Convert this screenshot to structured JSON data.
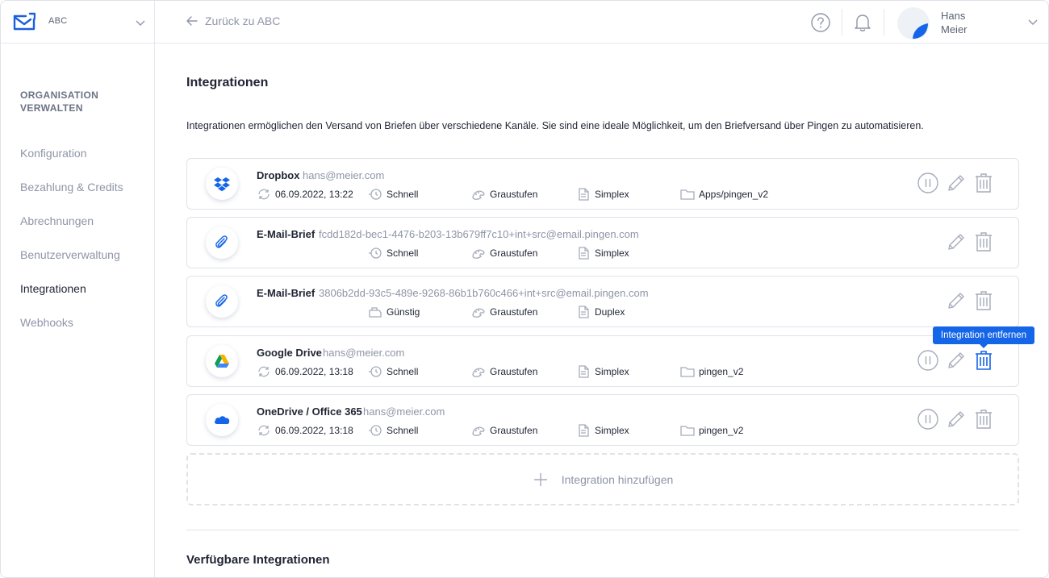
{
  "org": {
    "name": "ABC"
  },
  "header": {
    "back_label": "Zurück zu ABC",
    "user_first": "Hans",
    "user_last": "Meier"
  },
  "sidebar": {
    "heading": "ORGANISATION VERWALTEN",
    "items": [
      {
        "label": "Konfiguration"
      },
      {
        "label": "Bezahlung & Credits"
      },
      {
        "label": "Abrechnungen"
      },
      {
        "label": "Benutzerverwaltung"
      },
      {
        "label": "Integrationen",
        "active": true
      },
      {
        "label": "Webhooks"
      }
    ]
  },
  "main": {
    "title": "Integrationen",
    "intro": "Integrationen ermöglichen den Versand von Briefen über verschiedene Kanäle. Sie sind eine ideale Möglichkeit, um den Briefversand über Pingen zu automatisieren.",
    "integrations": [
      {
        "name": "Dropbox",
        "account": "hans@meier.com",
        "synced": "06.09.2022, 13:22",
        "speed": "Schnell",
        "color": "Graustufen",
        "print": "Simplex",
        "folder": "Apps/pingen_v2",
        "icon": "dropbox-icon"
      },
      {
        "name": "E-Mail-Brief",
        "account": "fcdd182d-bec1-4476-b203-13b679ff7c10+int+src@email.pingen.com",
        "speed": "Schnell",
        "color": "Graustufen",
        "print": "Simplex",
        "icon": "paperclip-icon"
      },
      {
        "name": "E-Mail-Brief",
        "account": "3806b2dd-93c5-489e-9268-86b1b760c466+int+src@email.pingen.com",
        "speed": "Günstig",
        "color": "Graustufen",
        "print": "Duplex",
        "icon": "paperclip-icon"
      },
      {
        "name": "Google Drive",
        "account": "hans@meier.com",
        "synced": "06.09.2022, 13:18",
        "speed": "Schnell",
        "color": "Graustufen",
        "print": "Simplex",
        "folder": "pingen_v2",
        "icon": "google-drive-icon"
      },
      {
        "name": "OneDrive / Office 365",
        "account": "hans@meier.com",
        "synced": "06.09.2022, 13:18",
        "speed": "Schnell",
        "color": "Graustufen",
        "print": "Simplex",
        "folder": "pingen_v2",
        "icon": "onedrive-icon"
      }
    ],
    "add_label": "Integration hinzufügen",
    "available_title": "Verfügbare Integrationen",
    "tooltip": "Integration entfernen"
  },
  "colors": {
    "accent": "#1565e8",
    "muted": "#8e95a7",
    "icon_stroke": "#a6acba"
  }
}
